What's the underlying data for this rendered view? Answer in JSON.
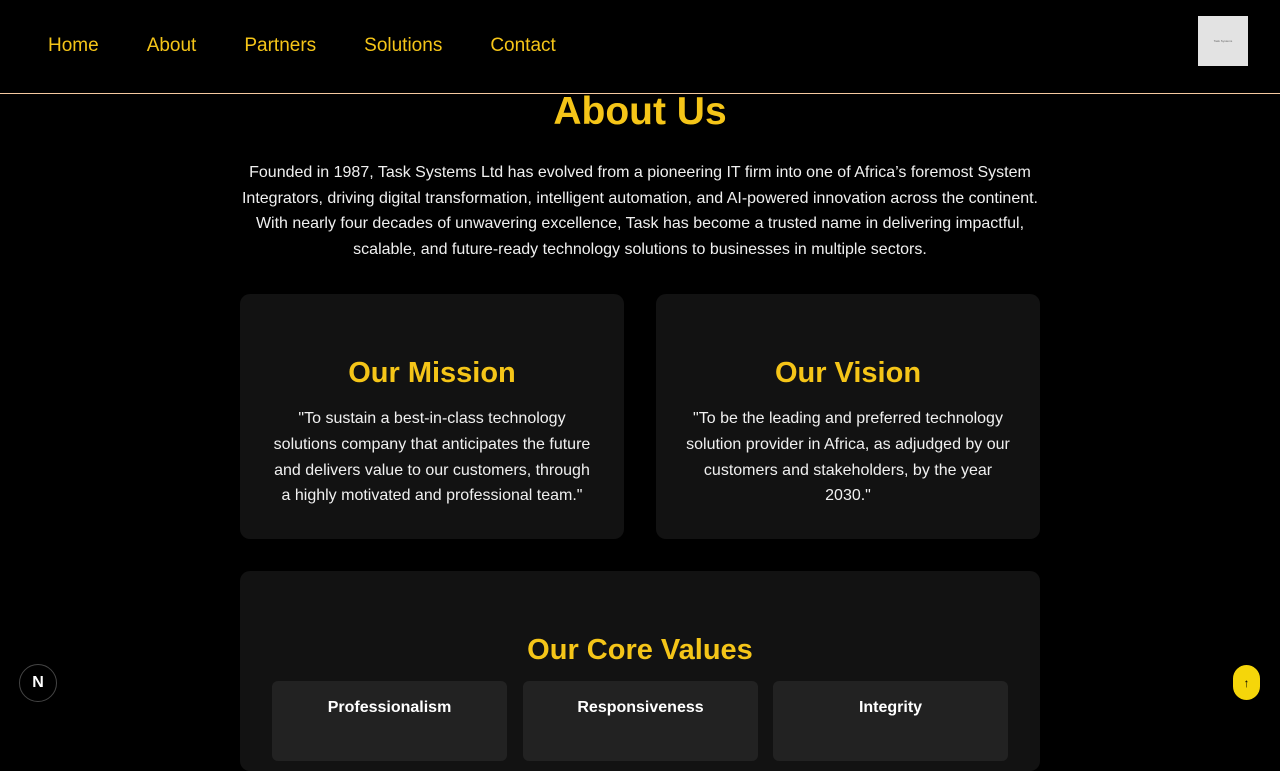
{
  "nav": {
    "items": [
      {
        "label": "Home"
      },
      {
        "label": "About"
      },
      {
        "label": "Partners"
      },
      {
        "label": "Solutions"
      },
      {
        "label": "Contact"
      }
    ],
    "logo_text": "Task Systems"
  },
  "about": {
    "title": "About Us",
    "paragraph": "Founded in 1987, Task Systems Ltd has evolved from a pioneering IT firm into one of Africa’s foremost System Integrators, driving digital transformation, intelligent automation, and AI-powered innovation across the continent. With nearly four decades of unwavering excellence, Task has become a trusted name in delivering impactful, scalable, and future-ready technology solutions to businesses in multiple sectors."
  },
  "mission": {
    "title": "Our Mission",
    "text": "\"To sustain a best-in-class technology solutions company that anticipates the future and delivers value to our customers, through a highly motivated and professional team.\""
  },
  "vision": {
    "title": "Our Vision",
    "text": "\"To be the leading and preferred technology solution provider in Africa, as adjudged by our customers and stakeholders, by the year 2030.\""
  },
  "core_values": {
    "title": "Our Core Values",
    "items": [
      {
        "label": "Professionalism"
      },
      {
        "label": "Responsiveness"
      },
      {
        "label": "Integrity"
      }
    ]
  },
  "widgets": {
    "next_badge": "N",
    "scroll_top": "↑"
  },
  "colors": {
    "accent": "#f5c518",
    "background": "#000000",
    "card": "#121212"
  }
}
